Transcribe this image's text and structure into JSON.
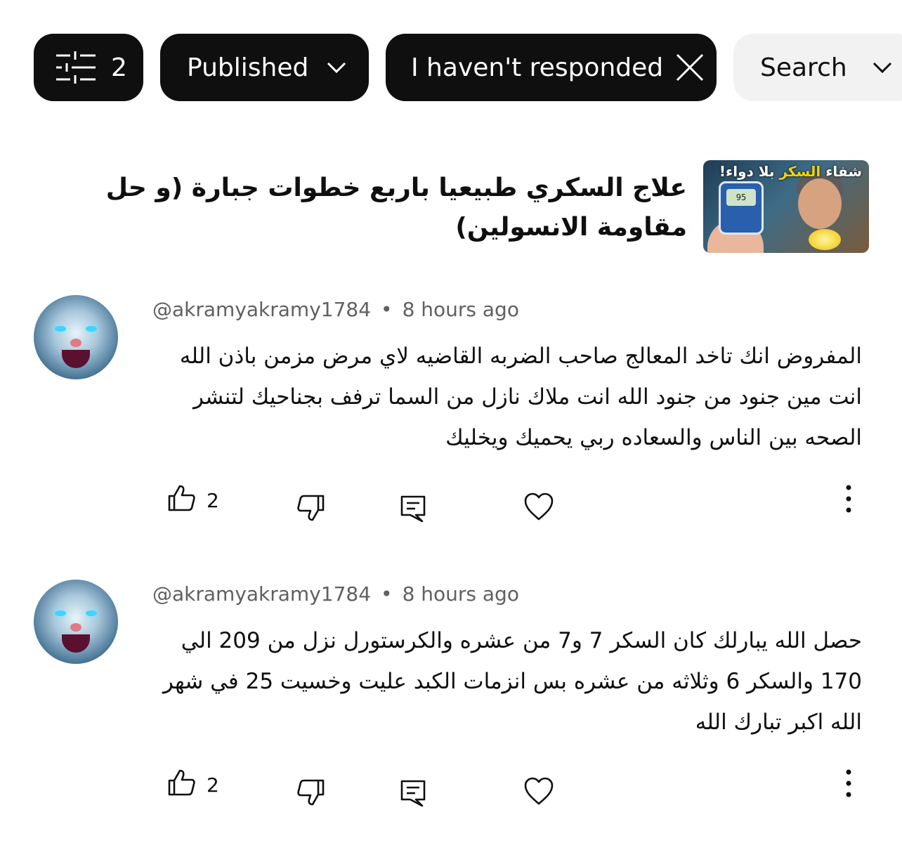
{
  "filters": {
    "count": "2",
    "published_label": "Published",
    "responded_label": "I haven't responded",
    "search_label": "Search"
  },
  "video": {
    "title": "علاج السكري طبيعيا باربع خطوات جبارة (و حل مقاومة الانسولين)",
    "thumbnail_text_a": "شفاء",
    "thumbnail_text_b": "السكر",
    "thumbnail_text_c": "بلا دواء!",
    "thumbnail_meter": "95"
  },
  "comments": [
    {
      "author": "@akramyakramy1784",
      "separator": "•",
      "time": "8 hours ago",
      "text": "المفروض انك تاخد المعالج صاحب الضربه القاضيه لاي مرض مزمن باذن الله انت مين جنود من جنود الله انت ملاك نازل من السما ترفف بجناحيك لتنشر الصحه بين الناس والسعاده ربي يحميك ويخليك",
      "likes": "2"
    },
    {
      "author": "@akramyakramy1784",
      "separator": "•",
      "time": "8 hours ago",
      "text": "حصل الله يبارلك كان السكر 7 و7 من عشره والكرستورل نزل من 209 الي 170 والسكر 6 وثلاثه من عشره  بس انزمات الكبد  عليت  وخسيت 25 في شهر الله اكبر تبارك الله",
      "likes": "2"
    }
  ],
  "icons": [
    "filter-sliders-icon",
    "chevron-down-icon",
    "close-icon",
    "thumbs-up-icon",
    "thumbs-down-icon",
    "reply-icon",
    "heart-icon",
    "more-vertical-icon"
  ],
  "colors": {
    "chip_dark": "#0f0f0f",
    "chip_light": "#f2f2f2",
    "meta_gray": "#606060"
  }
}
